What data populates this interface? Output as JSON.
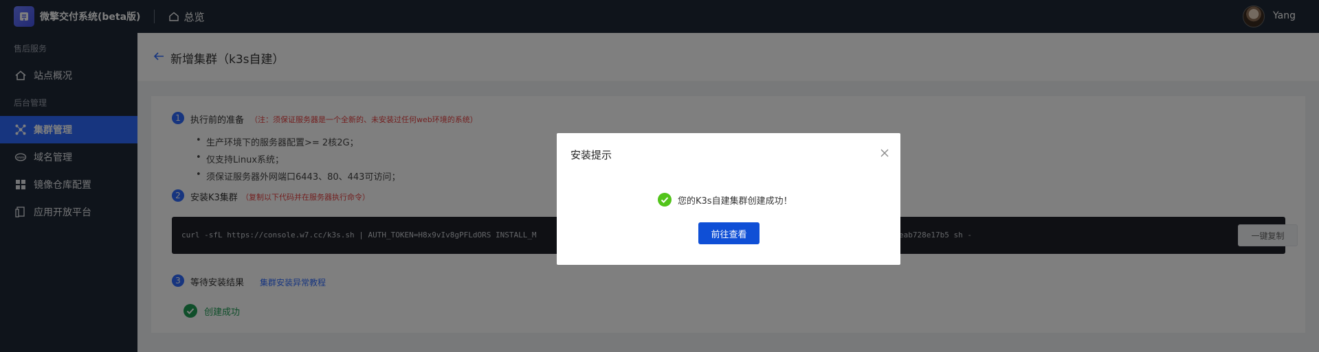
{
  "app": {
    "title": "微擎交付系统(beta版)",
    "overview_label": "总览",
    "user_name": "Yang"
  },
  "sidebar": {
    "groups": [
      {
        "label": "售后服务"
      },
      {
        "label": "后台管理"
      }
    ],
    "items": [
      {
        "label": "站点概况",
        "icon": "home-icon"
      },
      {
        "label": "集群管理",
        "icon": "cluster-icon",
        "active": true
      },
      {
        "label": "域名管理",
        "icon": "www-icon"
      },
      {
        "label": "镜像仓库配置",
        "icon": "grid-icon"
      },
      {
        "label": "应用开放平台",
        "icon": "app-icon"
      }
    ]
  },
  "page": {
    "title": "新增集群（k3s自建）"
  },
  "steps": [
    {
      "num": "1",
      "title": "执行前的准备",
      "note": "（注：须保证服务器是一个全新的、未安装过任何web环境的系统）",
      "bullets": [
        "生产环境下的服务器配置>= 2核2G；",
        "仅支持Linux系统；",
        "须保证服务器外网端口6443、80、443可访问；"
      ]
    },
    {
      "num": "2",
      "title": "安装K3集群",
      "note": "（复制以下代码并在服务器执行命令）",
      "code": "curl -sfL https://console.w7.cc/k3s.sh | AUTH_TOKEN=H8x9vIv8gPFLdORS INSTALL_M",
      "code_tail": "eab728e17b5 sh -",
      "copy_label": "一键复制"
    },
    {
      "num": "3",
      "title": "等待安装结果",
      "link": "集群安装异常教程",
      "status": "创建成功"
    }
  ],
  "modal": {
    "title": "安装提示",
    "message": "您的K3s自建集群创建成功！",
    "button": "前往查看"
  },
  "colors": {
    "primary": "#2f6bff",
    "sidebar_bg": "#1f2937",
    "success": "#1f9d55",
    "note_red": "#e64040"
  }
}
